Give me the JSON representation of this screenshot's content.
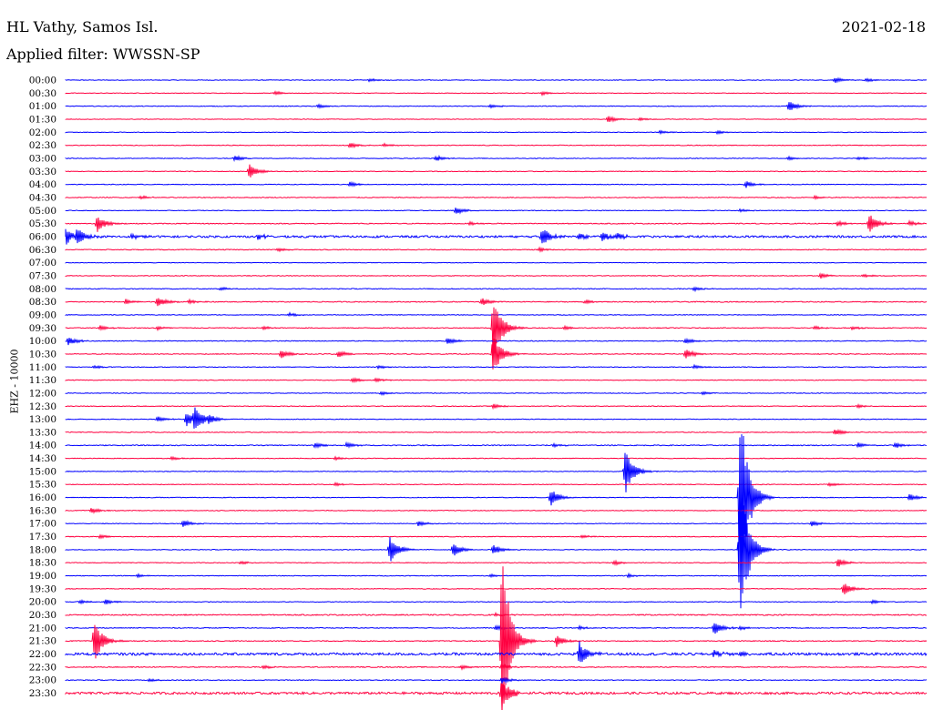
{
  "header": {
    "station": "HL Vathy, Samos Isl.",
    "filter": "Applied filter: WWSSN-SP",
    "date": "2021-02-18"
  },
  "y_axis_label": "EHZ - 10000",
  "colors": {
    "even_row": "#0000ff",
    "odd_row": "#ff0040",
    "text": "#000000",
    "background": "#ffffff"
  },
  "chart_data": {
    "type": "line",
    "title": "",
    "ylabel": "EHZ - 10000",
    "rows": [
      "00:00",
      "00:30",
      "01:00",
      "01:30",
      "02:00",
      "02:30",
      "03:00",
      "03:30",
      "04:00",
      "04:30",
      "05:00",
      "05:30",
      "06:00",
      "06:30",
      "07:00",
      "07:30",
      "08:00",
      "08:30",
      "09:00",
      "09:30",
      "10:00",
      "10:30",
      "11:00",
      "11:30",
      "12:00",
      "12:30",
      "13:00",
      "13:30",
      "14:00",
      "14:30",
      "15:00",
      "15:30",
      "16:00",
      "16:30",
      "17:00",
      "17:30",
      "18:00",
      "18:30",
      "19:00",
      "19:30",
      "20:00",
      "20:30",
      "21:00",
      "21:30",
      "22:00",
      "22:30",
      "23:00",
      "23:30"
    ],
    "row_duration_min": 30,
    "noise_level": [
      0.6,
      0.5,
      0.6,
      0.5,
      0.5,
      0.6,
      0.6,
      0.6,
      0.6,
      0.7,
      0.6,
      0.8,
      1.8,
      0.7,
      0.5,
      0.6,
      0.7,
      0.8,
      0.6,
      0.7,
      0.7,
      0.7,
      0.6,
      0.6,
      0.6,
      0.6,
      0.6,
      0.6,
      0.8,
      0.6,
      0.6,
      0.6,
      0.6,
      0.6,
      0.6,
      0.6,
      0.6,
      0.6,
      0.6,
      0.6,
      0.6,
      1.0,
      0.7,
      0.8,
      2.2,
      0.8,
      0.7,
      2.0
    ],
    "events": [
      {
        "row": "00:00",
        "min": 10.6,
        "amp": 2
      },
      {
        "row": "00:00",
        "min": 26.8,
        "amp": 3
      },
      {
        "row": "00:00",
        "min": 27.9,
        "amp": 2
      },
      {
        "row": "00:30",
        "min": 7.3,
        "amp": 2
      },
      {
        "row": "00:30",
        "min": 16.6,
        "amp": 2
      },
      {
        "row": "01:00",
        "min": 8.8,
        "amp": 2
      },
      {
        "row": "01:00",
        "min": 14.8,
        "amp": 2
      },
      {
        "row": "01:00",
        "min": 25.2,
        "amp": 6
      },
      {
        "row": "01:30",
        "min": 18.9,
        "amp": 4
      },
      {
        "row": "01:30",
        "min": 20.0,
        "amp": 2
      },
      {
        "row": "02:00",
        "min": 20.7,
        "amp": 2
      },
      {
        "row": "02:00",
        "min": 22.7,
        "amp": 2
      },
      {
        "row": "02:30",
        "min": 9.9,
        "amp": 3
      },
      {
        "row": "02:30",
        "min": 11.1,
        "amp": 2
      },
      {
        "row": "03:00",
        "min": 5.9,
        "amp": 3
      },
      {
        "row": "03:00",
        "min": 12.9,
        "amp": 3
      },
      {
        "row": "03:00",
        "min": 25.2,
        "amp": 2
      },
      {
        "row": "03:00",
        "min": 27.6,
        "amp": 2
      },
      {
        "row": "03:30",
        "min": 6.4,
        "amp": 8
      },
      {
        "row": "04:00",
        "min": 9.9,
        "amp": 3
      },
      {
        "row": "04:00",
        "min": 23.7,
        "amp": 4
      },
      {
        "row": "04:30",
        "min": 2.6,
        "amp": 2
      },
      {
        "row": "04:30",
        "min": 26.1,
        "amp": 2
      },
      {
        "row": "05:00",
        "min": 13.6,
        "amp": 4
      },
      {
        "row": "05:00",
        "min": 23.5,
        "amp": 2
      },
      {
        "row": "05:30",
        "min": 1.1,
        "amp": 10
      },
      {
        "row": "05:30",
        "min": 14.1,
        "amp": 2
      },
      {
        "row": "05:30",
        "min": 26.9,
        "amp": 3
      },
      {
        "row": "05:30",
        "min": 28.0,
        "amp": 12
      },
      {
        "row": "05:30",
        "min": 29.4,
        "amp": 3
      },
      {
        "row": "06:00",
        "min": 0.0,
        "amp": 9
      },
      {
        "row": "06:00",
        "min": 0.4,
        "amp": 8
      },
      {
        "row": "06:00",
        "min": 2.3,
        "amp": 3
      },
      {
        "row": "06:00",
        "min": 6.7,
        "amp": 3
      },
      {
        "row": "06:00",
        "min": 16.6,
        "amp": 11
      },
      {
        "row": "06:00",
        "min": 17.9,
        "amp": 4
      },
      {
        "row": "06:00",
        "min": 18.7,
        "amp": 5
      },
      {
        "row": "06:00",
        "min": 19.2,
        "amp": 4
      },
      {
        "row": "06:30",
        "min": 7.4,
        "amp": 2
      },
      {
        "row": "06:30",
        "min": 16.5,
        "amp": 2
      },
      {
        "row": "07:30",
        "min": 26.3,
        "amp": 3
      },
      {
        "row": "07:30",
        "min": 27.8,
        "amp": 2
      },
      {
        "row": "08:00",
        "min": 5.4,
        "amp": 2
      },
      {
        "row": "08:00",
        "min": 21.9,
        "amp": 2
      },
      {
        "row": "08:30",
        "min": 2.1,
        "amp": 3
      },
      {
        "row": "08:30",
        "min": 3.2,
        "amp": 6
      },
      {
        "row": "08:30",
        "min": 4.3,
        "amp": 2
      },
      {
        "row": "08:30",
        "min": 14.5,
        "amp": 5
      },
      {
        "row": "08:30",
        "min": 18.1,
        "amp": 2
      },
      {
        "row": "09:00",
        "min": 7.8,
        "amp": 2
      },
      {
        "row": "09:30",
        "min": 1.2,
        "amp": 3
      },
      {
        "row": "09:30",
        "min": 3.2,
        "amp": 2
      },
      {
        "row": "09:30",
        "min": 6.9,
        "amp": 2
      },
      {
        "row": "09:30",
        "min": 14.9,
        "amp": 40
      },
      {
        "row": "09:30",
        "min": 17.4,
        "amp": 2
      },
      {
        "row": "09:30",
        "min": 26.1,
        "amp": 2
      },
      {
        "row": "09:30",
        "min": 27.4,
        "amp": 2
      },
      {
        "row": "10:00",
        "min": 0.1,
        "amp": 5
      },
      {
        "row": "10:00",
        "min": 13.3,
        "amp": 4
      },
      {
        "row": "10:00",
        "min": 21.6,
        "amp": 3
      },
      {
        "row": "10:30",
        "min": 7.5,
        "amp": 5
      },
      {
        "row": "10:30",
        "min": 9.5,
        "amp": 4
      },
      {
        "row": "10:30",
        "min": 14.9,
        "amp": 24
      },
      {
        "row": "10:30",
        "min": 21.6,
        "amp": 6
      },
      {
        "row": "11:00",
        "min": 1.0,
        "amp": 2
      },
      {
        "row": "11:00",
        "min": 10.9,
        "amp": 2
      },
      {
        "row": "11:00",
        "min": 21.9,
        "amp": 2
      },
      {
        "row": "11:30",
        "min": 10.0,
        "amp": 3
      },
      {
        "row": "11:30",
        "min": 10.8,
        "amp": 2
      },
      {
        "row": "12:00",
        "min": 11.0,
        "amp": 2
      },
      {
        "row": "12:00",
        "min": 22.2,
        "amp": 2
      },
      {
        "row": "12:30",
        "min": 14.9,
        "amp": 3
      },
      {
        "row": "12:30",
        "min": 27.6,
        "amp": 2
      },
      {
        "row": "13:00",
        "min": 3.2,
        "amp": 3
      },
      {
        "row": "13:00",
        "min": 4.2,
        "amp": 9
      },
      {
        "row": "13:00",
        "min": 4.5,
        "amp": 14
      },
      {
        "row": "13:00",
        "min": 5.0,
        "amp": 4
      },
      {
        "row": "13:30",
        "min": 26.8,
        "amp": 4
      },
      {
        "row": "14:00",
        "min": 8.7,
        "amp": 3
      },
      {
        "row": "14:00",
        "min": 9.8,
        "amp": 3
      },
      {
        "row": "14:00",
        "min": 17.0,
        "amp": 2
      },
      {
        "row": "14:00",
        "min": 27.6,
        "amp": 3
      },
      {
        "row": "14:00",
        "min": 28.9,
        "amp": 3
      },
      {
        "row": "14:30",
        "min": 3.7,
        "amp": 2
      },
      {
        "row": "14:30",
        "min": 9.4,
        "amp": 2
      },
      {
        "row": "15:00",
        "min": 19.5,
        "amp": 26
      },
      {
        "row": "15:30",
        "min": 9.4,
        "amp": 2
      },
      {
        "row": "15:30",
        "min": 26.6,
        "amp": 2
      },
      {
        "row": "16:00",
        "min": 16.9,
        "amp": 10
      },
      {
        "row": "16:00",
        "min": 23.5,
        "amp": 120
      },
      {
        "row": "16:00",
        "min": 29.4,
        "amp": 4
      },
      {
        "row": "16:30",
        "min": 0.9,
        "amp": 3
      },
      {
        "row": "17:00",
        "min": 4.1,
        "amp": 4
      },
      {
        "row": "17:00",
        "min": 12.3,
        "amp": 3
      },
      {
        "row": "17:00",
        "min": 26.0,
        "amp": 3
      },
      {
        "row": "17:30",
        "min": 1.2,
        "amp": 2
      },
      {
        "row": "17:30",
        "min": 18.0,
        "amp": 2
      },
      {
        "row": "18:00",
        "min": 11.3,
        "amp": 16
      },
      {
        "row": "18:00",
        "min": 13.5,
        "amp": 8
      },
      {
        "row": "18:00",
        "min": 14.9,
        "amp": 6
      },
      {
        "row": "18:00",
        "min": 23.5,
        "amp": 90
      },
      {
        "row": "18:30",
        "min": 6.1,
        "amp": 2
      },
      {
        "row": "18:30",
        "min": 19.1,
        "amp": 3
      },
      {
        "row": "18:30",
        "min": 26.9,
        "amp": 5
      },
      {
        "row": "19:00",
        "min": 2.5,
        "amp": 2
      },
      {
        "row": "19:00",
        "min": 14.8,
        "amp": 2
      },
      {
        "row": "19:00",
        "min": 19.6,
        "amp": 2
      },
      {
        "row": "19:30",
        "min": 27.1,
        "amp": 8
      },
      {
        "row": "20:00",
        "min": 0.5,
        "amp": 2
      },
      {
        "row": "20:00",
        "min": 1.4,
        "amp": 3
      },
      {
        "row": "20:00",
        "min": 28.1,
        "amp": 2
      },
      {
        "row": "20:30",
        "min": 15.0,
        "amp": 2
      },
      {
        "row": "21:00",
        "min": 15.0,
        "amp": 3
      },
      {
        "row": "21:00",
        "min": 17.9,
        "amp": 2
      },
      {
        "row": "21:00",
        "min": 22.6,
        "amp": 8
      },
      {
        "row": "21:00",
        "min": 23.5,
        "amp": 2
      },
      {
        "row": "21:30",
        "min": 1.0,
        "amp": 24
      },
      {
        "row": "21:30",
        "min": 15.2,
        "amp": 110
      },
      {
        "row": "21:30",
        "min": 17.1,
        "amp": 7
      },
      {
        "row": "22:00",
        "min": 17.9,
        "amp": 14
      },
      {
        "row": "22:00",
        "min": 22.6,
        "amp": 4
      },
      {
        "row": "22:00",
        "min": 23.5,
        "amp": 3
      },
      {
        "row": "22:30",
        "min": 6.9,
        "amp": 2
      },
      {
        "row": "22:30",
        "min": 13.8,
        "amp": 2
      },
      {
        "row": "22:30",
        "min": 15.2,
        "amp": 3
      },
      {
        "row": "23:00",
        "min": 2.9,
        "amp": 2
      },
      {
        "row": "23:00",
        "min": 15.2,
        "amp": 4
      },
      {
        "row": "23:30",
        "min": 15.2,
        "amp": 18
      }
    ]
  }
}
